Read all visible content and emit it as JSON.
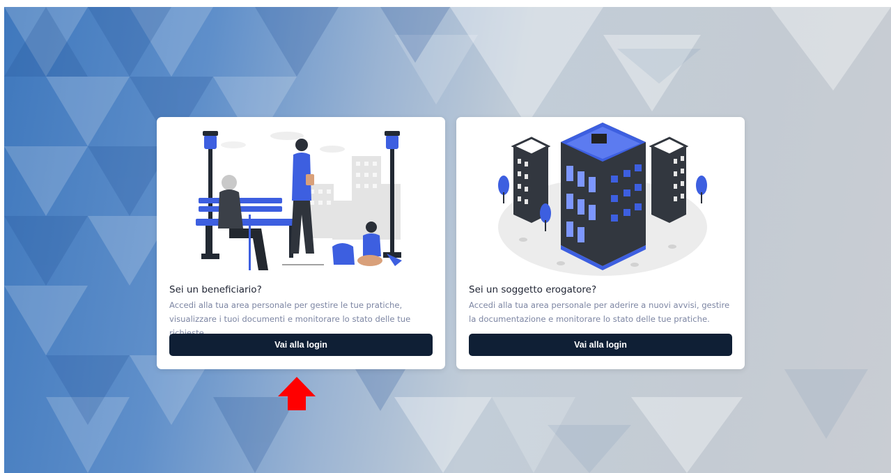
{
  "cards": [
    {
      "illustration": "park-people-illustration",
      "title": "Sei un beneficiario?",
      "description": "Accedi alla tua area personale per gestire le tue pratiche, visualizzare i tuoi documenti e monitorare lo stato delle tue richieste.",
      "button_label": "Vai alla login"
    },
    {
      "illustration": "buildings-illustration",
      "title": "Sei un soggetto erogatore?",
      "description": "Accedi alla tua area personale per aderire a nuovi avvisi, gestire la documentazione e monitorare lo stato delle tue pratiche.",
      "button_label": "Vai alla login"
    }
  ],
  "annotation": {
    "icon": "red-up-arrow-icon"
  },
  "colors": {
    "accent_blue": "#3d5fe0",
    "button_dark": "#0f1f35",
    "description_text": "#7d86a3",
    "arrow_red": "#ff0000"
  }
}
